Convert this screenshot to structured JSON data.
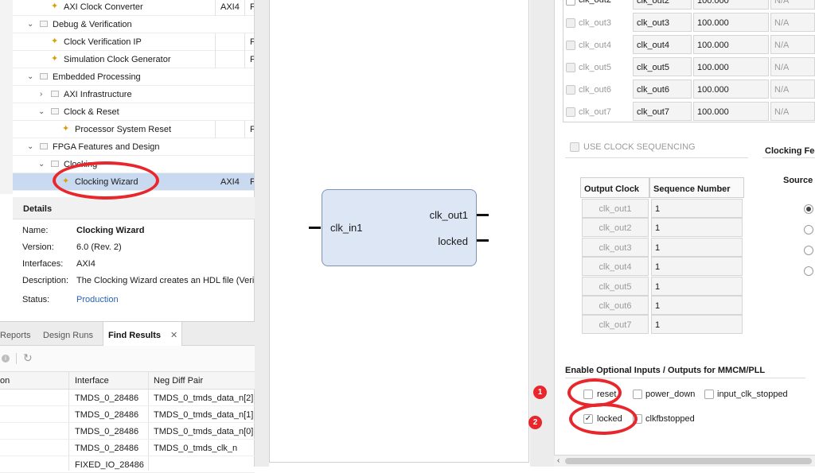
{
  "tree": {
    "rows": [
      {
        "label": "AXI Clock Converter",
        "interface": "AXI4",
        "col3": "F",
        "type": "ip",
        "indent": 1
      },
      {
        "label": "Debug & Verification",
        "type": "folder",
        "indent": 0
      },
      {
        "label": "Clock Verification IP",
        "col3": "F",
        "type": "ip",
        "indent": 1
      },
      {
        "label": "Simulation Clock Generator",
        "col3": "F",
        "type": "ip",
        "indent": 1
      },
      {
        "label": "Embedded Processing",
        "type": "folder",
        "indent": 0
      },
      {
        "label": "AXI Infrastructure",
        "type": "folder-collapsed",
        "indent": 1
      },
      {
        "label": "Clock & Reset",
        "type": "folder",
        "indent": 1
      },
      {
        "label": "Processor System Reset",
        "col3": "F",
        "type": "ip",
        "indent": 2
      },
      {
        "label": "FPGA Features and Design",
        "type": "folder",
        "indent": 0
      },
      {
        "label": "Clocking",
        "type": "folder",
        "indent": 1
      },
      {
        "label": "Clocking Wizard",
        "interface": "AXI4",
        "col3": "F",
        "type": "ip",
        "indent": 2,
        "selected": true
      }
    ]
  },
  "details": {
    "title": "Details",
    "name_key": "Name:",
    "name_val": "Clocking Wizard",
    "version_key": "Version:",
    "version_val": "6.0 (Rev. 2)",
    "interfaces_key": "Interfaces:",
    "interfaces_val": "AXI4",
    "description_key": "Description:",
    "description_val": "The Clocking Wizard creates an HDL file (Verilo",
    "status_key": "Status:",
    "status_val": "Production"
  },
  "bottom": {
    "tabs": [
      "Reports",
      "Design Runs",
      "Find Results"
    ],
    "active_tab": "Find Results",
    "columns": [
      "on",
      "Interface",
      "Neg Diff Pair"
    ],
    "rows": [
      {
        "interface": "TMDS_0_28486",
        "neg": "TMDS_0_tmds_data_n[2]"
      },
      {
        "interface": "TMDS_0_28486",
        "neg": "TMDS_0_tmds_data_n[1]"
      },
      {
        "interface": "TMDS_0_28486",
        "neg": "TMDS_0_tmds_data_n[0]"
      },
      {
        "interface": "TMDS_0_28486",
        "neg": "TMDS_0_tmds_clk_n"
      },
      {
        "interface": "FIXED_IO_28486",
        "neg": ""
      }
    ]
  },
  "symbol": {
    "input_port": "clk_in1",
    "output_ports": [
      "clk_out1",
      "locked"
    ]
  },
  "config": {
    "output_clocks": [
      {
        "port": "clk_out2",
        "name": "clk_out2",
        "freq": "100.000",
        "actual": "N/A"
      },
      {
        "port": "clk_out3",
        "name": "clk_out3",
        "freq": "100.000",
        "actual": "N/A"
      },
      {
        "port": "clk_out4",
        "name": "clk_out4",
        "freq": "100.000",
        "actual": "N/A"
      },
      {
        "port": "clk_out5",
        "name": "clk_out5",
        "freq": "100.000",
        "actual": "N/A"
      },
      {
        "port": "clk_out6",
        "name": "clk_out6",
        "freq": "100.000",
        "actual": "N/A"
      },
      {
        "port": "clk_out7",
        "name": "clk_out7",
        "freq": "100.000",
        "actual": "N/A"
      }
    ],
    "use_clock_sequencing": "USE CLOCK SEQUENCING",
    "clocking_feedback": "Clocking Fee",
    "source_label": "Source",
    "sequence_table": {
      "headers": [
        "Output Clock",
        "Sequence Number"
      ],
      "rows": [
        {
          "clock": "clk_out1",
          "seq": "1"
        },
        {
          "clock": "clk_out2",
          "seq": "1"
        },
        {
          "clock": "clk_out3",
          "seq": "1"
        },
        {
          "clock": "clk_out4",
          "seq": "1"
        },
        {
          "clock": "clk_out5",
          "seq": "1"
        },
        {
          "clock": "clk_out6",
          "seq": "1"
        },
        {
          "clock": "clk_out7",
          "seq": "1"
        }
      ]
    },
    "optional_io_title": "Enable Optional Inputs / Outputs for MMCM/PLL",
    "reset_label": "reset",
    "power_down_label": "power_down",
    "input_clk_stopped_label": "input_clk_stopped",
    "locked_label": "locked",
    "clkfbstopped_label": "clkfbstopped",
    "locked_checked": true
  },
  "annotations": {
    "badge1": "1",
    "badge2": "2",
    "accent": "#e8262b"
  }
}
